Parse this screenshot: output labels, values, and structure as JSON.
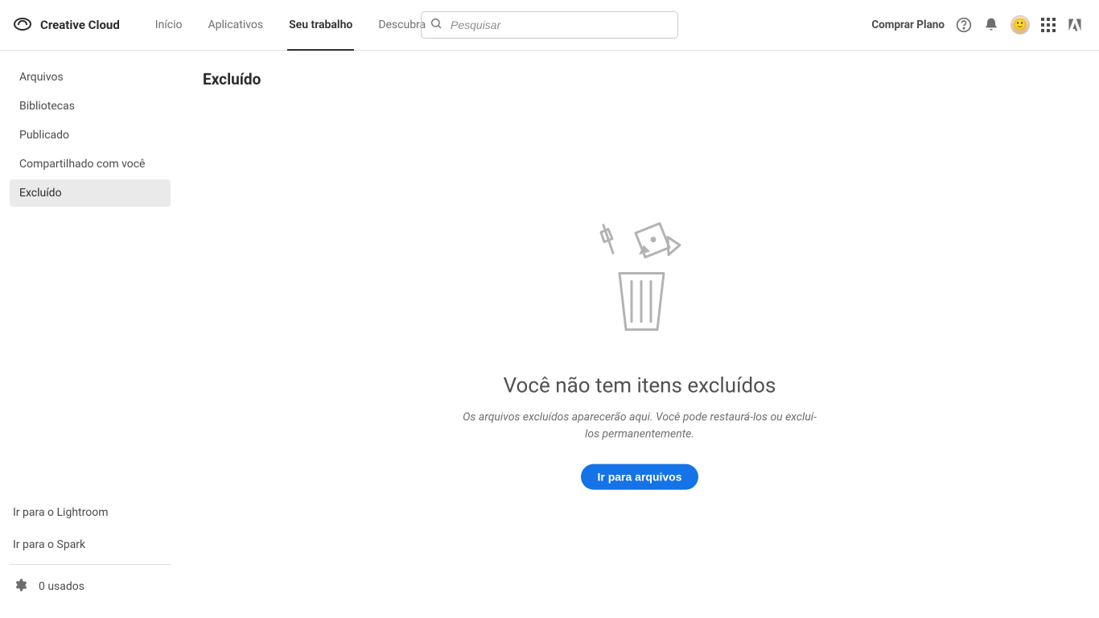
{
  "brand": "Creative Cloud",
  "nav": {
    "items": [
      {
        "label": "Início"
      },
      {
        "label": "Aplicativos"
      },
      {
        "label": "Seu trabalho"
      },
      {
        "label": "Descubra"
      }
    ]
  },
  "search": {
    "placeholder": "Pesquisar"
  },
  "header_right": {
    "plan_label": "Comprar Plano"
  },
  "sidebar": {
    "items": [
      {
        "label": "Arquivos"
      },
      {
        "label": "Bibliotecas"
      },
      {
        "label": "Publicado"
      },
      {
        "label": "Compartilhado com você"
      },
      {
        "label": "Excluído"
      }
    ],
    "links": [
      {
        "label": "Ir para o Lightroom"
      },
      {
        "label": "Ir para o Spark"
      }
    ],
    "storage": "0 usados"
  },
  "page": {
    "title": "Excluído",
    "empty": {
      "title": "Você não tem itens excluídos",
      "desc": "Os arquivos excluídos aparecerão aqui. Você pode restaurá-los ou excluí-los permanentemente.",
      "button": "Ir para arquivos"
    }
  }
}
